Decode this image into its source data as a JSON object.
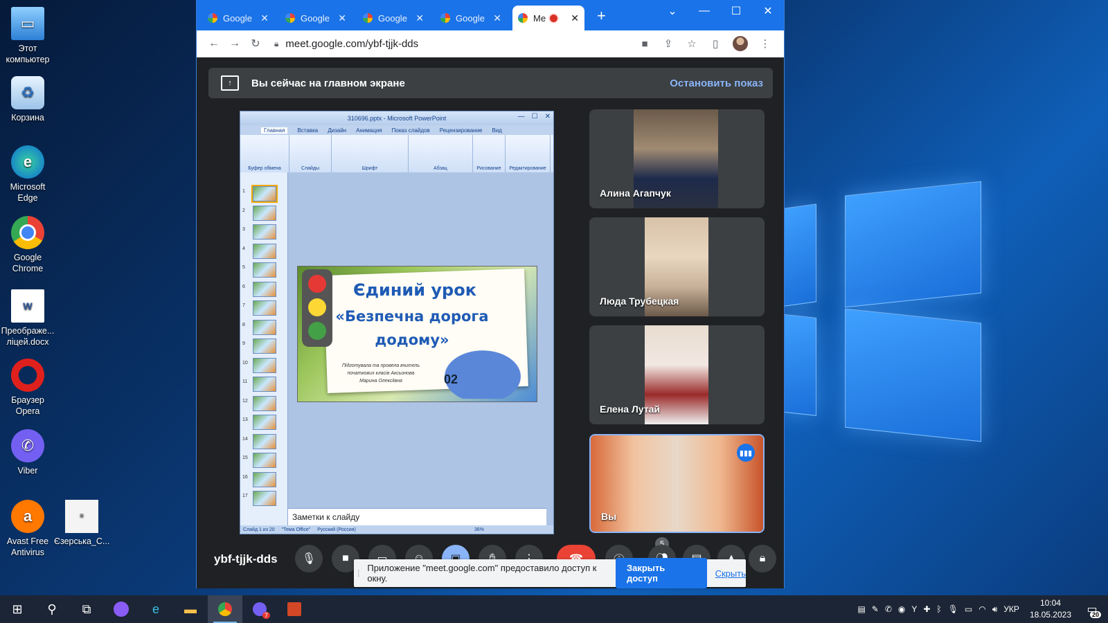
{
  "desktop": {
    "icons": [
      {
        "label": "Этот компьютер",
        "icon": "computer-icon"
      },
      {
        "label": "Корзина",
        "icon": "recycle-bin-icon"
      },
      {
        "label": "Microsoft Edge",
        "icon": "edge-icon"
      },
      {
        "label": "Google Chrome",
        "icon": "chrome-icon"
      },
      {
        "label": "Преображе... лiцей.docx",
        "icon": "word-doc-icon"
      },
      {
        "label": "Браузер Opera",
        "icon": "opera-icon"
      },
      {
        "label": "Viber",
        "icon": "viber-icon"
      },
      {
        "label": "Avast Free Antivirus",
        "icon": "avast-icon"
      },
      {
        "label": "Єзерська_С...",
        "icon": "document-icon"
      }
    ]
  },
  "browser": {
    "tabs": [
      {
        "label": "Google",
        "active": false
      },
      {
        "label": "Google",
        "active": false
      },
      {
        "label": "Google",
        "active": false
      },
      {
        "label": "Google",
        "active": false
      },
      {
        "label": "Me",
        "active": true
      }
    ],
    "url": "meet.google.com/ybf-tjjk-dds"
  },
  "meet": {
    "banner_text": "Вы сейчас на главном экране",
    "stop_label": "Остановить показ",
    "meeting_code": "ybf-tjjk-dds",
    "participants_count": "5",
    "participants": [
      {
        "name": "Алина Агапчук"
      },
      {
        "name": "Люда Трубецкая"
      },
      {
        "name": "Елена Лутай"
      },
      {
        "name": "Вы"
      }
    ],
    "share_notice": "Приложение \"meet.google.com\" предоставило доступ к окну.",
    "share_close": "Закрыть доступ",
    "share_hide": "Скрыть"
  },
  "ppt": {
    "title": "310696.pptx - Microsoft PowerPoint",
    "tabs": [
      "Главная",
      "Вставка",
      "Дизайн",
      "Анимация",
      "Показ слайдов",
      "Рецензирование",
      "Вид"
    ],
    "ribbon_groups": [
      "Буфер обмена",
      "Слайды",
      "Шрифт",
      "Абзац",
      "Рисование",
      "Редактирование"
    ],
    "slide_numbers": [
      "1",
      "2",
      "3",
      "4",
      "5",
      "6",
      "7",
      "8",
      "9",
      "10",
      "11",
      "12",
      "13",
      "14",
      "15",
      "16",
      "17"
    ],
    "slide_title_1": "Єдиний урок",
    "slide_title_2": "«Безпечна дорога додому»",
    "slide_subtitle": "Підготувала та провела вчитель початкових класів Аксьонова Марина Олексіївна",
    "car_number": "02",
    "notes_placeholder": "Заметки к слайду",
    "status_slide": "Слайд 1 из 20",
    "status_theme": "\"Тема Office\"",
    "status_lang": "Русский (Россия)",
    "zoom": "36%"
  },
  "taskbar": {
    "lang": "УКР",
    "time": "10:04",
    "date": "18.05.2023",
    "notifications": "20",
    "viber_badge": "7"
  }
}
